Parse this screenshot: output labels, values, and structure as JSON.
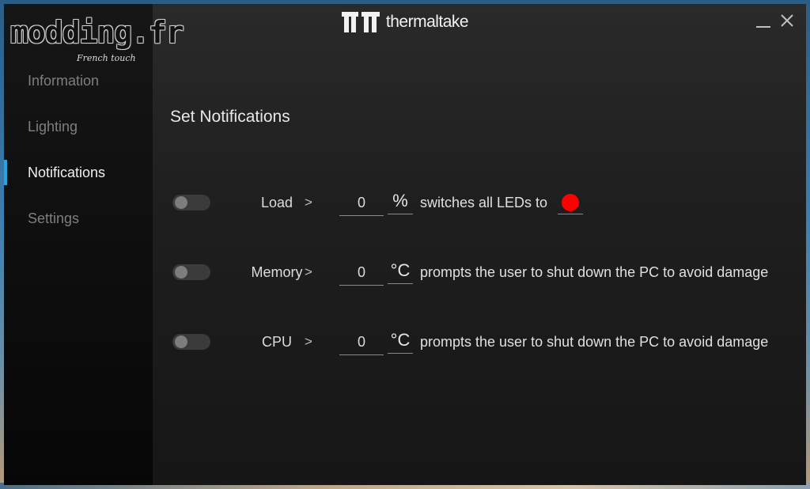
{
  "brand": {
    "name": "thermaltake",
    "logo_icon": "tt-logo-icon"
  },
  "watermark": {
    "text": "modding.fr",
    "subtext": "French touch"
  },
  "window_controls": {
    "minimize_icon": "minimize-icon",
    "close_icon": "close-icon"
  },
  "sidebar": {
    "items": [
      {
        "label": "Information",
        "active": false
      },
      {
        "label": "Lighting",
        "active": false
      },
      {
        "label": "Notifications",
        "active": true
      },
      {
        "label": "Settings",
        "active": false
      }
    ],
    "accent_color": "#29a3dd"
  },
  "main": {
    "title": "Set Notifications",
    "rows": [
      {
        "enabled": false,
        "label": "Load",
        "operator": ">",
        "value": "0",
        "unit": "%",
        "description": "switches all LEDs to",
        "led_color": "#ff0000"
      },
      {
        "enabled": false,
        "label": "Memory",
        "operator": ">",
        "value": "0",
        "unit": "°C",
        "description": "prompts the user to shut down the PC to avoid damage"
      },
      {
        "enabled": false,
        "label": "CPU",
        "operator": ">",
        "value": "0",
        "unit": "°C",
        "description": "prompts the user to shut down the PC to avoid damage"
      }
    ]
  }
}
